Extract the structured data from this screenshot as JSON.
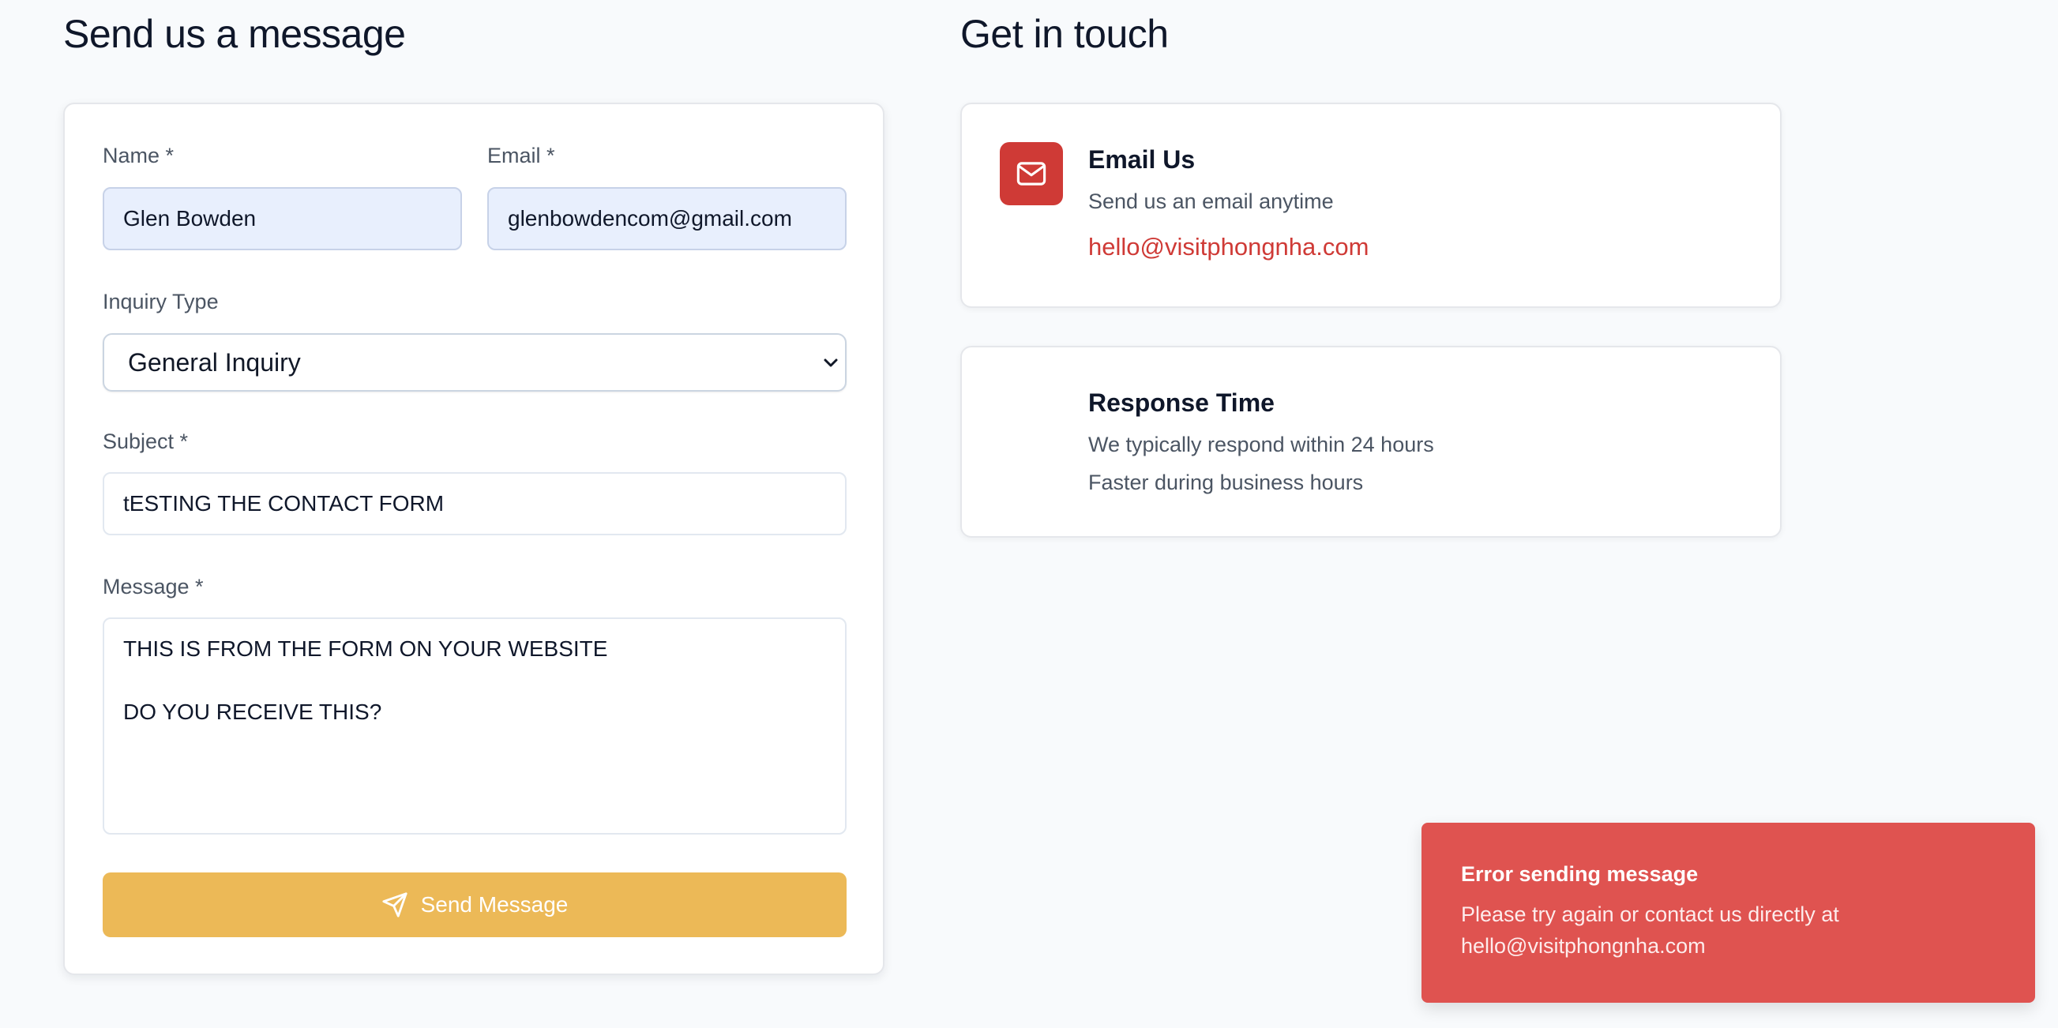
{
  "form_section": {
    "heading": "Send us a message",
    "name_label": "Name *",
    "name_value": "Glen Bowden",
    "email_label": "Email *",
    "email_value": "glenbowdencom@gmail.com",
    "inquiry_label": "Inquiry Type",
    "inquiry_value": "General Inquiry",
    "subject_label": "Subject *",
    "subject_value": "tESTING THE CONTACT FORM",
    "message_label": "Message *",
    "message_value": "THIS IS FROM THE FORM ON YOUR WEBSITE\n\nDO YOU RECEIVE THIS?",
    "send_label": "Send Message",
    "send_icon": "send-icon",
    "send_color": "#ecb957"
  },
  "contact_section": {
    "heading": "Get in touch",
    "email_card": {
      "icon": "mail-icon",
      "title": "Email Us",
      "text": "Send us an email anytime",
      "link": "hello@visitphongnha.com",
      "accent": "#cf3a36"
    },
    "response_card": {
      "title": "Response Time",
      "line1": "We typically respond within 24 hours",
      "line2": "Faster during business hours"
    }
  },
  "toast": {
    "title": "Error sending message",
    "body": "Please try again or contact us directly at hello@visitphongnha.com",
    "color": "#df5350"
  }
}
